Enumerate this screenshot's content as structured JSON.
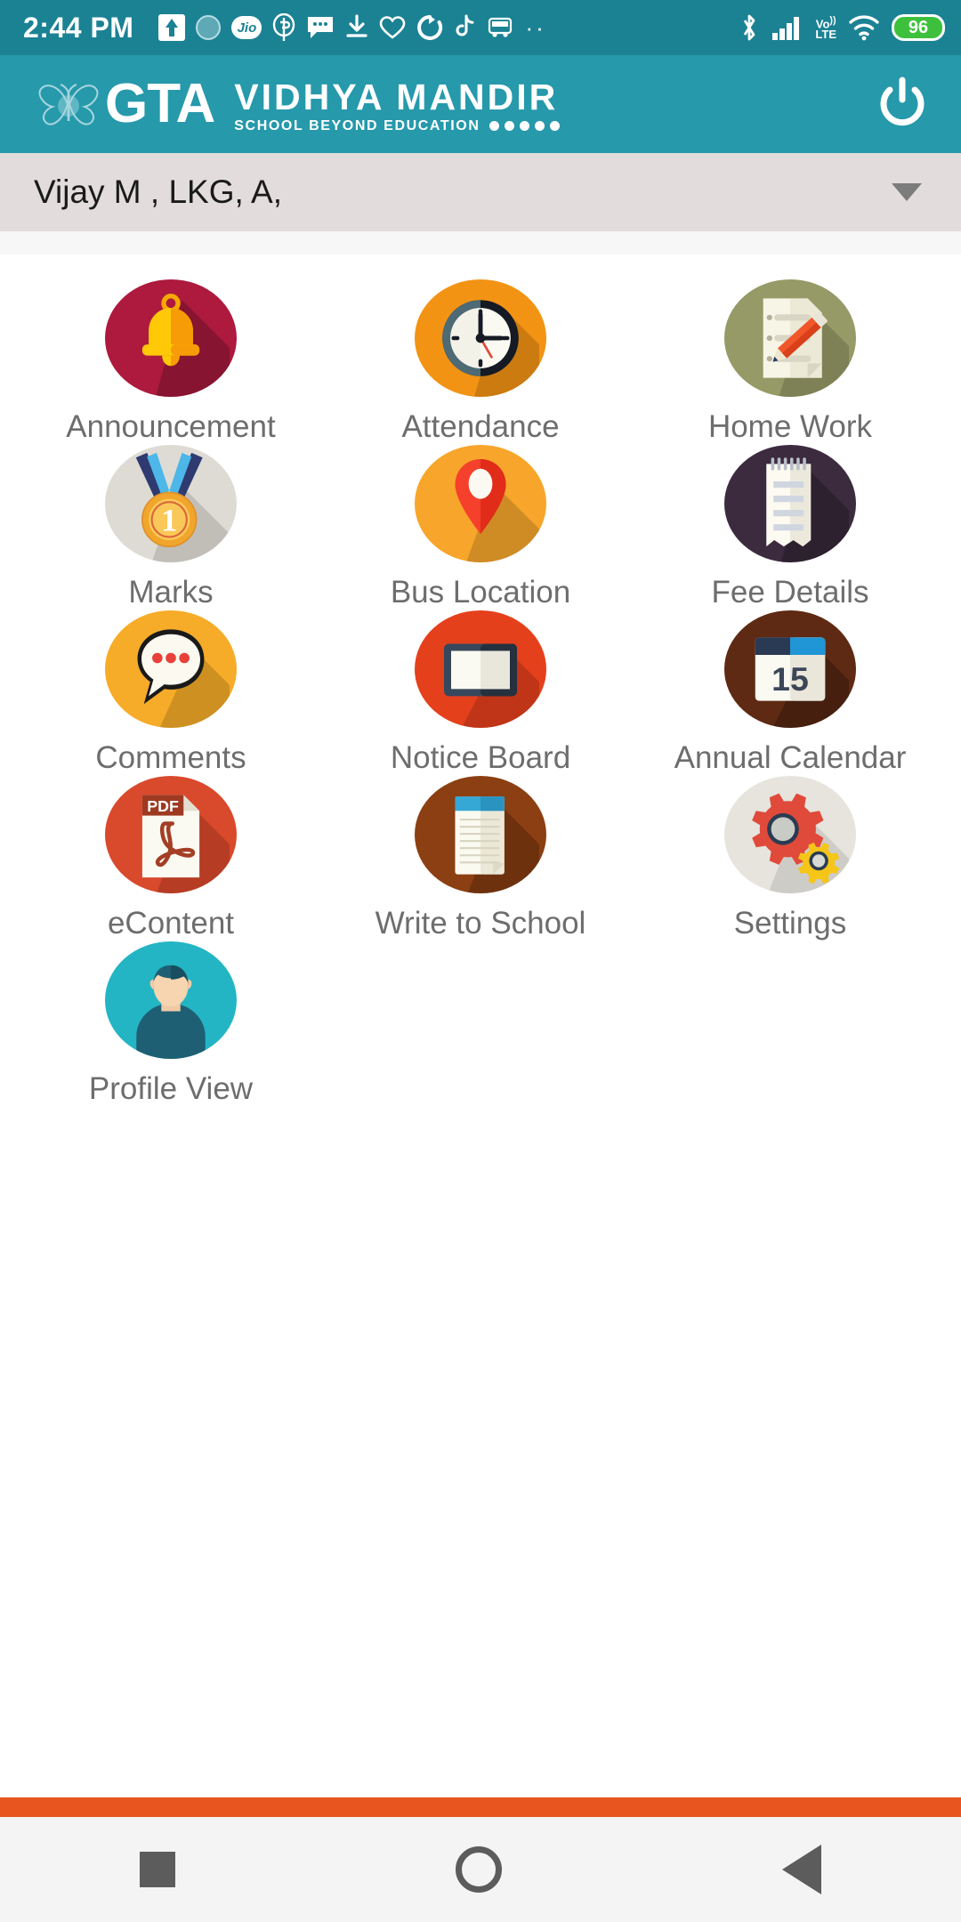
{
  "statusbar": {
    "time": "2:44 PM",
    "battery": "96",
    "volte": "VoLTE",
    "jio_label": "Jio",
    "icons": [
      "upload-arrow-icon",
      "circle-badge-icon",
      "jio-icon",
      "paytm-icon",
      "message-icon",
      "download-icon",
      "heart-icon",
      "sync-icon",
      "tiktok-icon",
      "redbus-icon",
      "more-dots-icon"
    ],
    "right_icons": [
      "bluetooth-icon",
      "signal-bars-icon",
      "volte-icon",
      "wifi-icon",
      "battery-icon"
    ]
  },
  "header": {
    "logo_text": "GTA",
    "school_name": "VIDHYA MANDIR",
    "tagline": "SCHOOL BEYOND EDUCATION",
    "tagline_dots": 5,
    "power_icon": "power-icon",
    "bg_color": "#2699ab"
  },
  "selector": {
    "value": "Vijay M , LKG, A,",
    "caret_icon": "chevron-down-icon",
    "bg_color": "#e2dcdc"
  },
  "grid": {
    "items": [
      {
        "label": "Announcement",
        "icon": "bell-icon",
        "bg": "#ad1a3e"
      },
      {
        "label": "Attendance",
        "icon": "clock-icon",
        "bg": "#f39314"
      },
      {
        "label": "Home Work",
        "icon": "homework-icon",
        "bg": "#969a66"
      },
      {
        "label": "Marks",
        "icon": "medal-icon",
        "bg": "#dedbd4"
      },
      {
        "label": "Bus Location",
        "icon": "map-pin-icon",
        "bg": "#f7a62b"
      },
      {
        "label": "Fee Details",
        "icon": "notepad-icon",
        "bg": "#3c2b3f"
      },
      {
        "label": "Comments",
        "icon": "comment-icon",
        "bg": "#f6ac28"
      },
      {
        "label": "Notice Board",
        "icon": "board-icon",
        "bg": "#e5401c"
      },
      {
        "label": "Annual Calendar",
        "icon": "calendar-icon",
        "bg": "#5e2a13"
      },
      {
        "label": "eContent",
        "icon": "pdf-icon",
        "bg": "#d9492c"
      },
      {
        "label": "Write to School",
        "icon": "notebook-icon",
        "bg": "#8c3f12"
      },
      {
        "label": "Settings",
        "icon": "gears-icon",
        "bg": "#e6e4dd"
      },
      {
        "label": "Profile View",
        "icon": "profile-icon",
        "bg": "#23b5c4"
      }
    ],
    "calendar_day": "15",
    "medal_number": "1",
    "pdf_label": "PDF"
  },
  "bottom": {
    "accent_color": "#e8551f",
    "nav_buttons": [
      "recents-square-icon",
      "home-circle-icon",
      "back-triangle-icon"
    ]
  }
}
